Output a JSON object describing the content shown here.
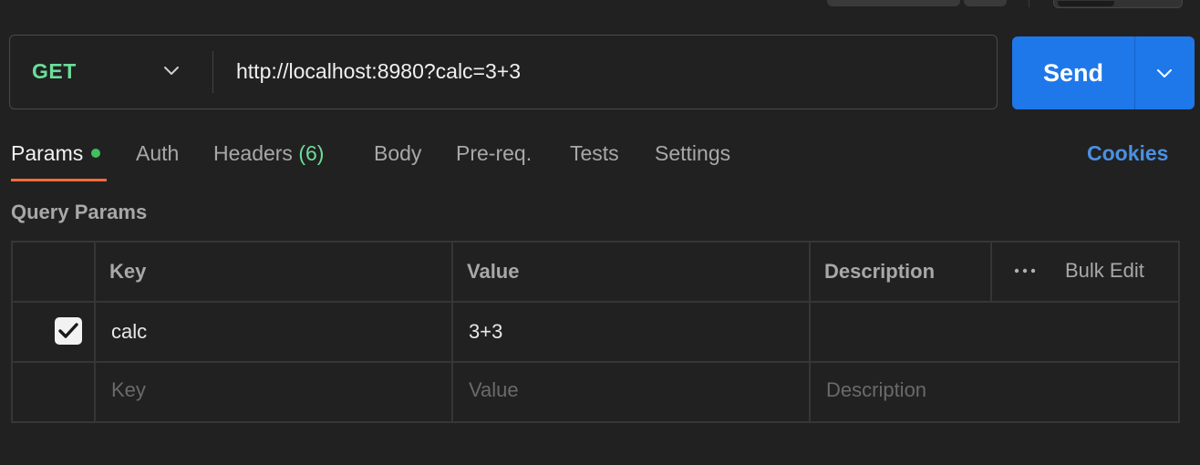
{
  "request": {
    "method": "GET",
    "url": "http://localhost:8980?calc=3+3",
    "send_label": "Send"
  },
  "tabs": [
    {
      "label": "Params",
      "active": true,
      "indicator_dot": true
    },
    {
      "label": "Auth"
    },
    {
      "label": "Headers",
      "count": "(6)"
    },
    {
      "label": "Body"
    },
    {
      "label": "Pre-req."
    },
    {
      "label": "Tests"
    },
    {
      "label": "Settings"
    }
  ],
  "cookies_label": "Cookies",
  "query_params": {
    "title": "Query Params",
    "columns": {
      "key": "Key",
      "value": "Value",
      "description": "Description",
      "bulk_edit": "Bulk Edit"
    },
    "rows": [
      {
        "enabled": true,
        "key": "calc",
        "value": "3+3",
        "description": ""
      }
    ],
    "placeholders": {
      "key": "Key",
      "value": "Value",
      "description": "Description"
    }
  },
  "icons": {
    "method_dropdown": "chevron-down-icon",
    "send_dropdown": "chevron-down-icon",
    "more": "more-horizontal-icon",
    "check": "checkmark-icon"
  },
  "colors": {
    "method": "#6bdd9a",
    "send_button": "#1f78ea",
    "active_tab_underline": "#f26b3a",
    "cookies_link": "#4a90e2",
    "params_dot": "#3fbf5f"
  }
}
